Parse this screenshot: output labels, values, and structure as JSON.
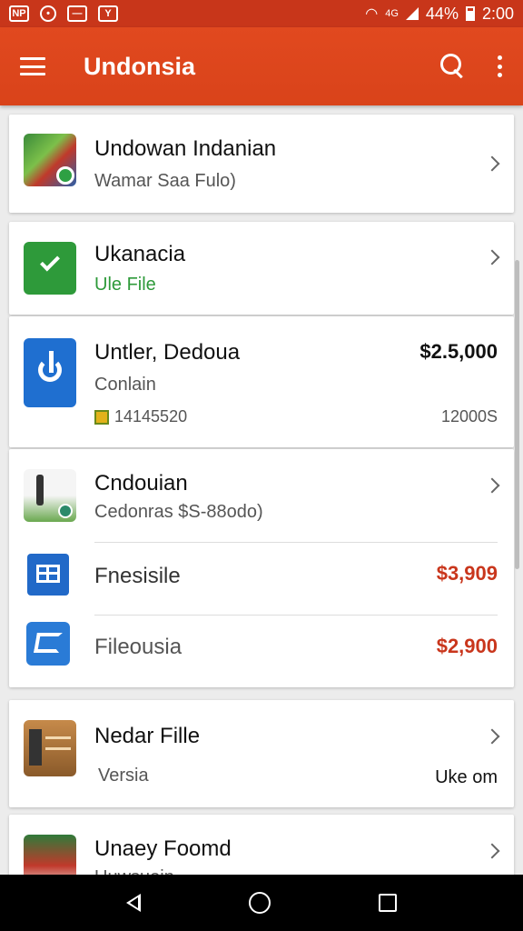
{
  "status_bar": {
    "icons": [
      "NP",
      "clock-icon",
      "message-icon",
      "Y"
    ],
    "network": "4G",
    "battery": "44%",
    "time": "2:00"
  },
  "app_bar": {
    "title": "Undonsia"
  },
  "items": [
    {
      "title": "Undowan Indanian",
      "subtitle": "Wamar Saa Fulo)",
      "icon": "landscape-app-icon"
    },
    {
      "title": "Ukanacia",
      "subtitle": "Ule File",
      "subtitle_color": "#2e9a3a",
      "icon": "green-check-icon"
    },
    {
      "title": "Untler, Dedoua",
      "subtitle": "Conlain",
      "meta_left": "14145520",
      "meta_right": "12000S",
      "price": "$2.5,000",
      "icon": "blue-app-icon"
    },
    {
      "title": "Cndouian",
      "subtitle": "Cedonras $S-88odo)",
      "icon": "golf-app-icon"
    },
    {
      "title": "Fnesisile",
      "price": "$3,909",
      "price_color": "#c9361c",
      "icon": "blue-doc-icon"
    },
    {
      "title": "Fileousia",
      "price": "$2,900",
      "price_color": "#c9361c",
      "icon": "blue-box-icon"
    },
    {
      "title": "Nedar Fille",
      "subtitle": "Versia",
      "meta_right": "Uke om",
      "icon": "wood-app-icon"
    },
    {
      "title": "Unaey Foomd",
      "subtitle": "Uuwsuoin",
      "icon": "house-app-icon"
    }
  ]
}
